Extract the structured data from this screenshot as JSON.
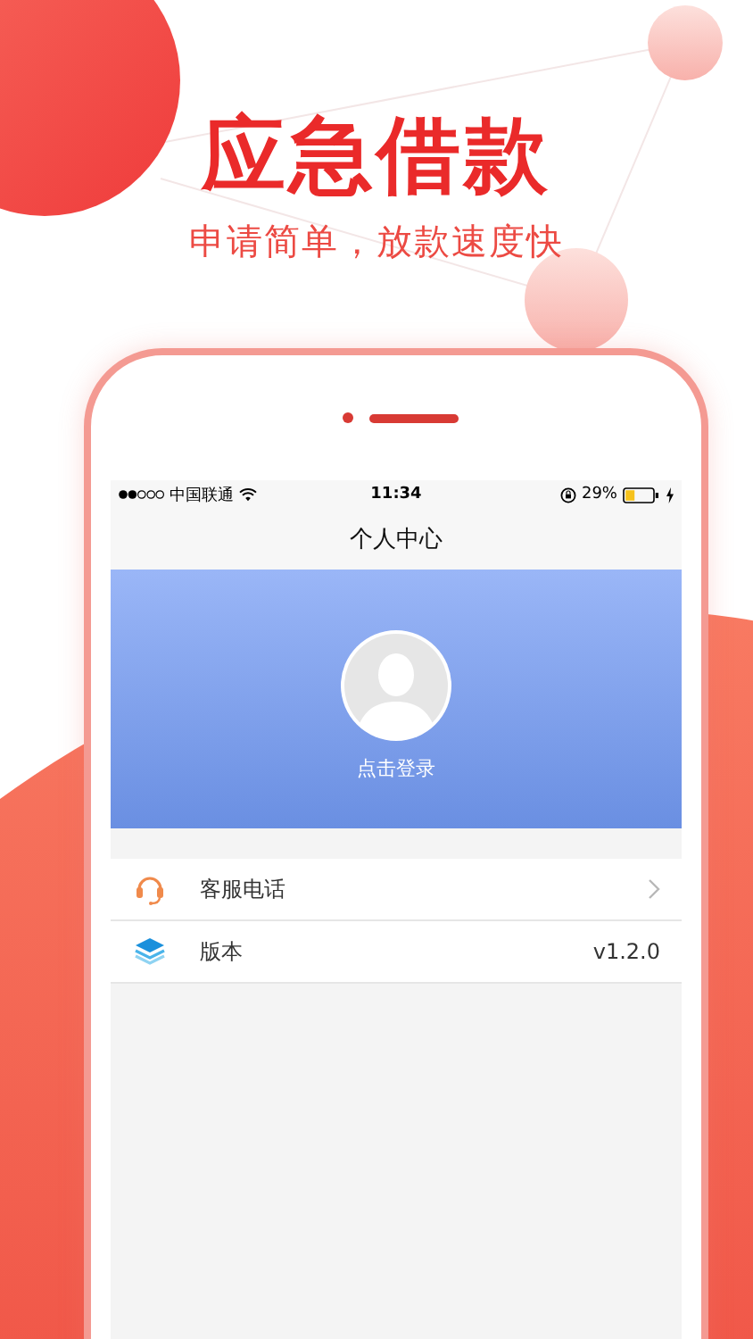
{
  "promo": {
    "headline": "应急借款",
    "subtitle": "申请简单，放款速度快"
  },
  "status_bar": {
    "carrier": "中国联通",
    "time": "11:34",
    "battery": "29%"
  },
  "nav_bar": {
    "title": "个人中心"
  },
  "profile": {
    "login_label": "点击登录"
  },
  "menu": [
    {
      "kind": "link",
      "label": "客服电话"
    },
    {
      "kind": "value",
      "label": "版本",
      "value": "v1.2.0"
    }
  ]
}
